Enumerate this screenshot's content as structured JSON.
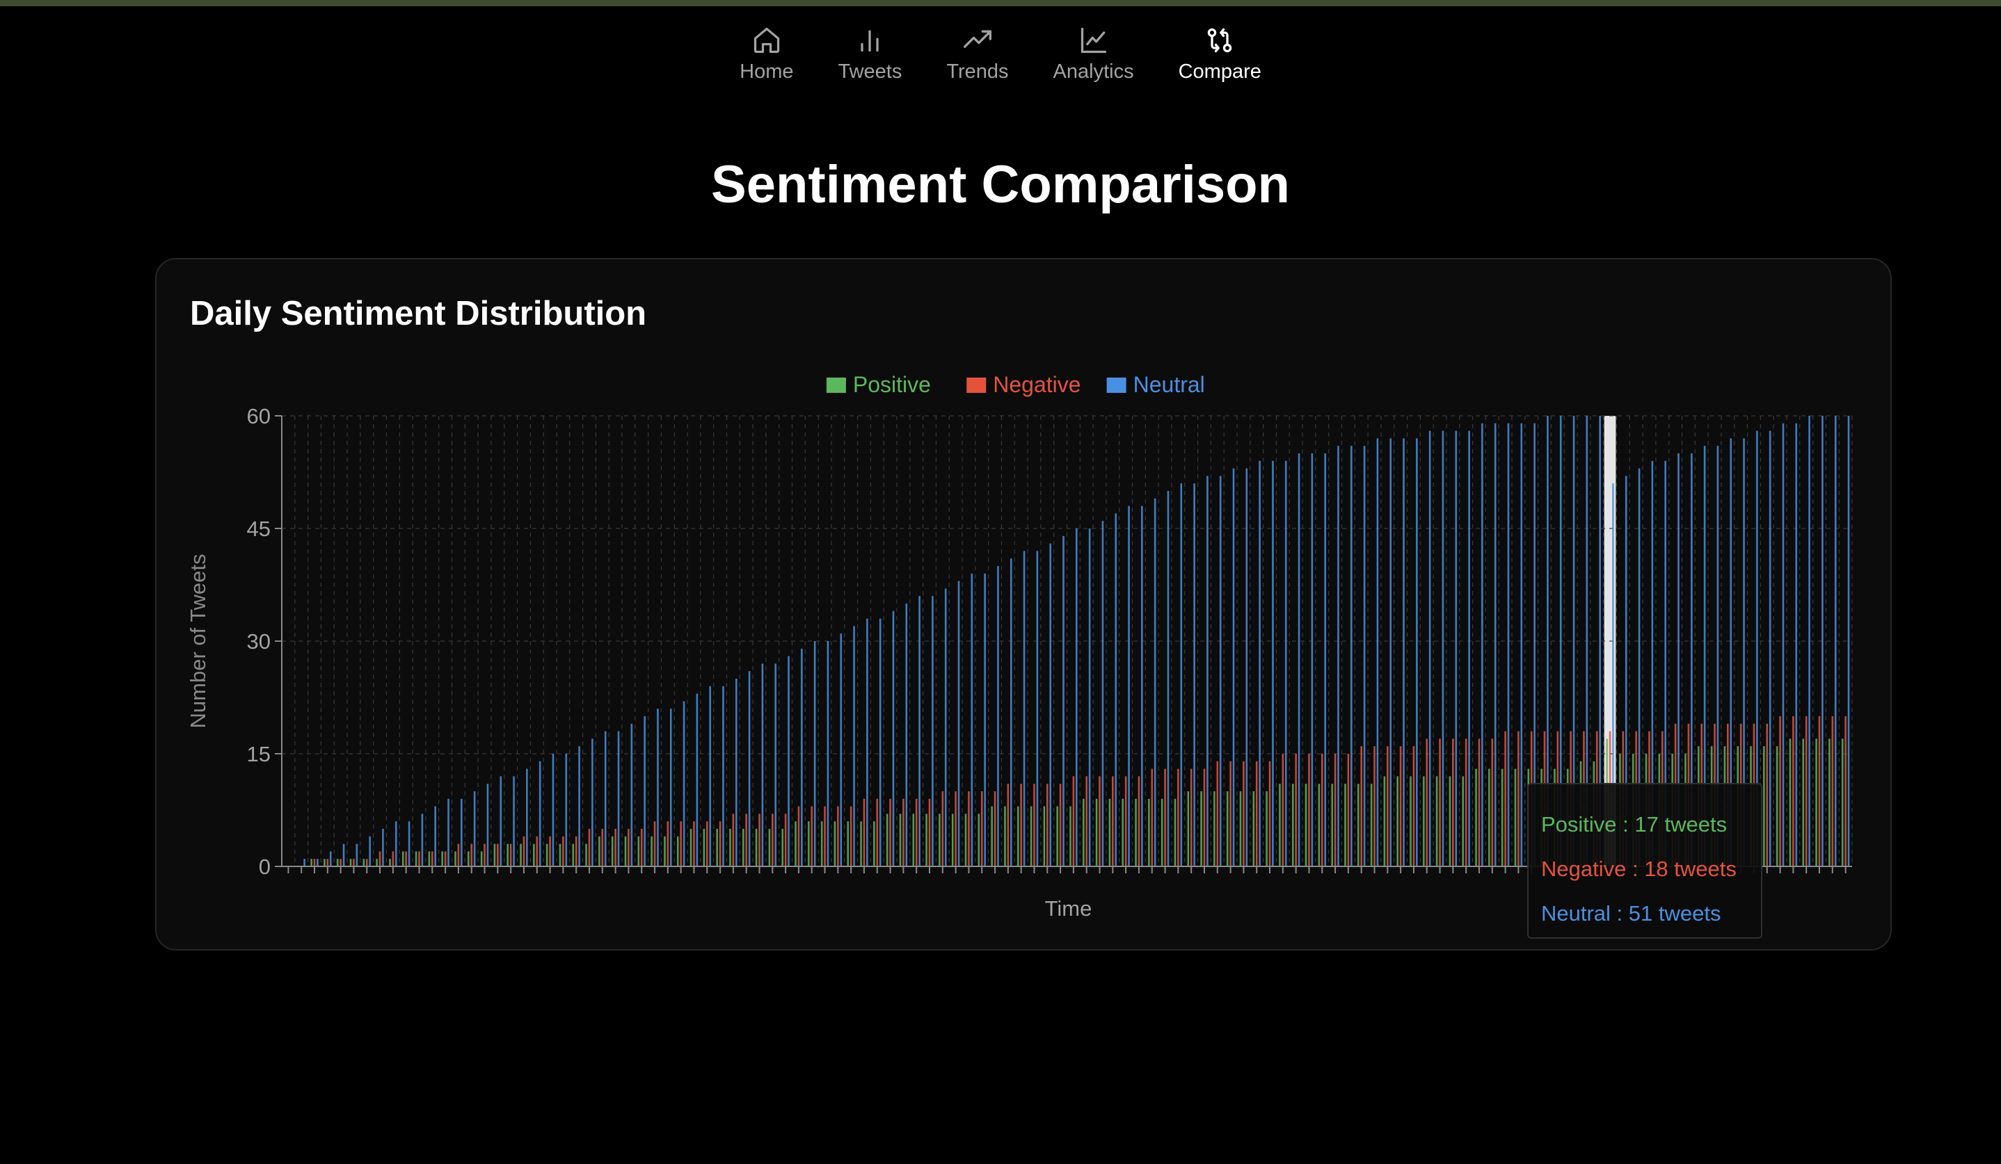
{
  "nav": {
    "items": [
      {
        "label": "Home",
        "icon": "home-icon",
        "active": false
      },
      {
        "label": "Tweets",
        "icon": "bar-chart-icon",
        "active": false
      },
      {
        "label": "Trends",
        "icon": "trending-up-icon",
        "active": false
      },
      {
        "label": "Analytics",
        "icon": "line-chart-icon",
        "active": false
      },
      {
        "label": "Compare",
        "icon": "git-compare-icon",
        "active": true
      }
    ]
  },
  "page": {
    "title": "Sentiment Comparison"
  },
  "card": {
    "title": "Daily Sentiment Distribution"
  },
  "colors": {
    "positive": "#5cb85c",
    "negative": "#e5533d",
    "neutral": "#4a90e2",
    "background": "#000000",
    "card": "#0c0c0c"
  },
  "tooltip": {
    "positive": "Positive : 17 tweets",
    "negative": "Negative : 18 tweets",
    "neutral": "Neutral : 51 tweets"
  },
  "chart_data": {
    "type": "bar",
    "xlabel": "Time",
    "ylabel": "Number of Tweets",
    "ylim": [
      0,
      60
    ],
    "yticks": [
      0,
      15,
      30,
      45,
      60
    ],
    "grid": true,
    "legend": "top-center",
    "x_tick_labels_visible": false,
    "category_count": 120,
    "highlighted_index": 101,
    "series": [
      {
        "name": "Positive",
        "color": "#5cb85c",
        "values": [
          0,
          0,
          1,
          1,
          1,
          1,
          1,
          1,
          1,
          2,
          2,
          2,
          2,
          2,
          2,
          2,
          3,
          3,
          3,
          3,
          3,
          3,
          3,
          3,
          4,
          4,
          4,
          4,
          4,
          4,
          4,
          5,
          5,
          5,
          5,
          5,
          5,
          5,
          5,
          6,
          6,
          6,
          6,
          6,
          6,
          6,
          7,
          7,
          7,
          7,
          7,
          7,
          7,
          7,
          8,
          8,
          8,
          8,
          8,
          8,
          8,
          9,
          9,
          9,
          9,
          9,
          9,
          9,
          9,
          10,
          10,
          10,
          10,
          10,
          10,
          10,
          11,
          11,
          11,
          11,
          11,
          11,
          11,
          11,
          12,
          12,
          12,
          12,
          12,
          12,
          12,
          13,
          13,
          13,
          13,
          13,
          13,
          13,
          13,
          14,
          14,
          17,
          15,
          15,
          15,
          15,
          15,
          15,
          16,
          16,
          16,
          16,
          16,
          16,
          16,
          17,
          17,
          17,
          17,
          17
        ]
      },
      {
        "name": "Negative",
        "color": "#e5533d",
        "values": [
          0,
          0,
          1,
          1,
          1,
          1,
          1,
          2,
          2,
          2,
          2,
          2,
          2,
          3,
          3,
          3,
          3,
          3,
          4,
          4,
          4,
          4,
          4,
          5,
          5,
          5,
          5,
          5,
          6,
          6,
          6,
          6,
          6,
          6,
          7,
          7,
          7,
          7,
          7,
          8,
          8,
          8,
          8,
          8,
          9,
          9,
          9,
          9,
          9,
          9,
          10,
          10,
          10,
          10,
          10,
          11,
          11,
          11,
          11,
          11,
          12,
          12,
          12,
          12,
          12,
          12,
          13,
          13,
          13,
          13,
          13,
          14,
          14,
          14,
          14,
          14,
          15,
          15,
          15,
          15,
          15,
          15,
          16,
          16,
          16,
          16,
          16,
          17,
          17,
          17,
          17,
          17,
          17,
          18,
          18,
          18,
          18,
          18,
          18,
          18,
          18,
          18,
          18,
          18,
          18,
          18,
          19,
          19,
          19,
          19,
          19,
          19,
          19,
          19,
          20,
          20,
          20,
          20,
          20,
          20
        ]
      },
      {
        "name": "Neutral",
        "color": "#4a90e2",
        "values": [
          0,
          1,
          1,
          2,
          3,
          3,
          4,
          5,
          6,
          6,
          7,
          8,
          9,
          9,
          10,
          11,
          12,
          12,
          13,
          14,
          15,
          15,
          16,
          17,
          18,
          18,
          19,
          20,
          21,
          21,
          22,
          23,
          24,
          24,
          25,
          26,
          27,
          27,
          28,
          29,
          30,
          30,
          31,
          32,
          33,
          33,
          34,
          35,
          36,
          36,
          37,
          38,
          39,
          39,
          40,
          41,
          42,
          42,
          43,
          44,
          45,
          45,
          46,
          47,
          48,
          48,
          49,
          50,
          51,
          51,
          52,
          52,
          53,
          53,
          54,
          54,
          54,
          55,
          55,
          55,
          56,
          56,
          56,
          57,
          57,
          57,
          57,
          58,
          58,
          58,
          58,
          59,
          59,
          59,
          59,
          59,
          60,
          60,
          60,
          60,
          60,
          51,
          52,
          53,
          54,
          54,
          55,
          55,
          56,
          56,
          57,
          57,
          58,
          58,
          59,
          59,
          60,
          60,
          60,
          60
        ]
      }
    ]
  }
}
